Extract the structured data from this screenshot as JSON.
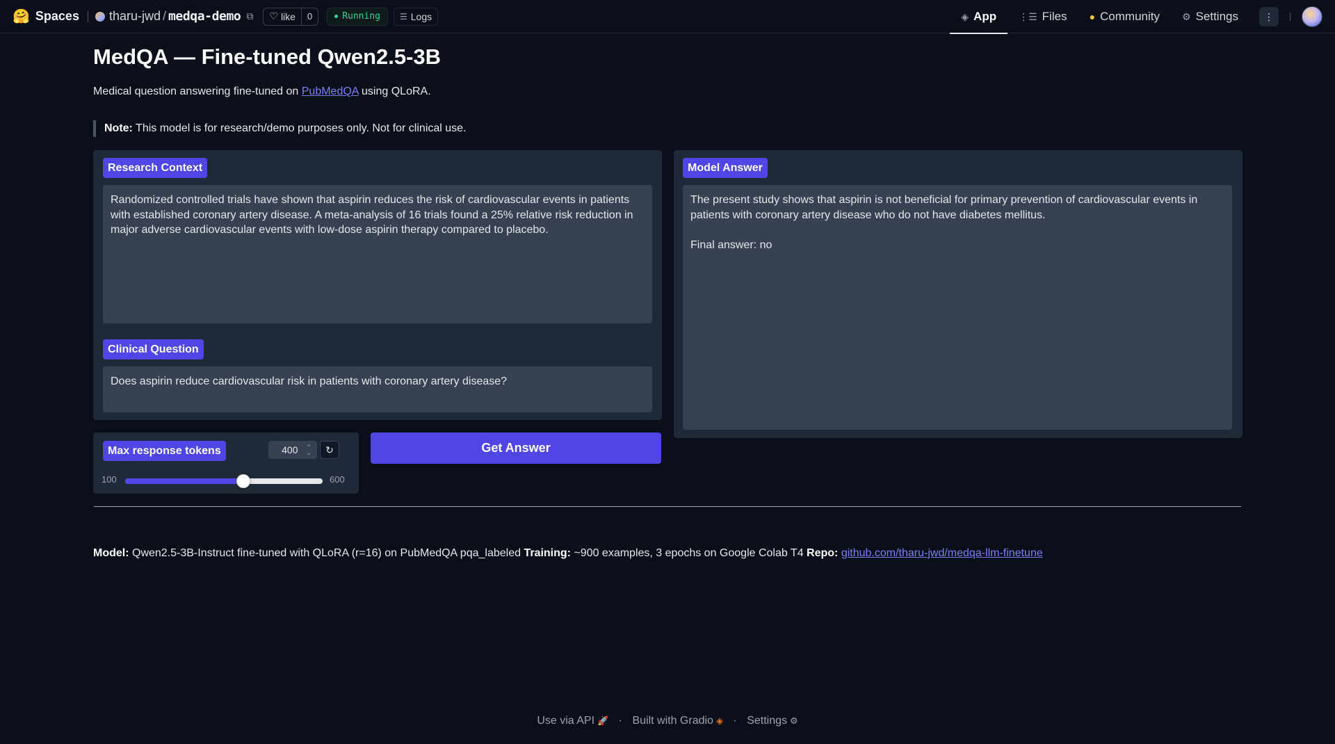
{
  "topbar": {
    "spaces_label": "Spaces",
    "owner": "tharu-jwd",
    "slash": "/",
    "repo": "medqa-demo",
    "like_label": "like",
    "like_count": "0",
    "status": "Running",
    "logs_label": "Logs",
    "tabs": [
      {
        "label": "App",
        "icon": "cube-icon",
        "active": true
      },
      {
        "label": "Files",
        "icon": "files-icon",
        "active": false
      },
      {
        "label": "Community",
        "icon": "community-icon",
        "active": false
      },
      {
        "label": "Settings",
        "icon": "gear-icon",
        "active": false
      }
    ]
  },
  "main": {
    "title": "MedQA — Fine-tuned Qwen2.5-3B",
    "subtitle_prefix": "Medical question answering fine-tuned on ",
    "subtitle_link": "PubMedQA",
    "subtitle_suffix": " using QLoRA.",
    "note_label": "Note:",
    "note_text": " This model is for research/demo purposes only. Not for clinical use."
  },
  "context": {
    "label": "Research Context",
    "value": "Randomized controlled trials have shown that aspirin reduces the risk of cardiovascular events in patients with established coronary artery disease. A meta-analysis of 16 trials found a 25% relative risk reduction in major adverse cardiovascular events with low-dose aspirin therapy compared to placebo."
  },
  "question": {
    "label": "Clinical Question",
    "value": "Does aspirin reduce cardiovascular risk in patients with coronary artery disease?"
  },
  "tokens": {
    "label": "Max response tokens",
    "value": "400",
    "min": "100",
    "max": "600",
    "fraction": 0.6
  },
  "submit_label": "Get Answer",
  "answer": {
    "label": "Model Answer",
    "line1": "The present study shows that aspirin is not beneficial for primary prevention of cardiovascular events in patients with coronary artery disease who do not have diabetes mellitus.",
    "line2": "Final answer: no"
  },
  "footer": {
    "model_label": "Model:",
    "model_text": " Qwen2.5-3B-Instruct fine-tuned with QLoRA (r=16) on PubMedQA pqa_labeled ",
    "training_label": "Training:",
    "training_text": " ~900 examples, 3 epochs on Google Colab T4 ",
    "repo_label": "Repo:",
    "repo_link": "github.com/tharu-jwd/medqa-llm-finetune"
  },
  "bottom": {
    "api": "Use via API",
    "sep": "·",
    "built": "Built with Gradio",
    "settings": "Settings"
  },
  "colors": {
    "accent": "#4f46e5",
    "background": "#0b0f19",
    "panel": "#1f2937",
    "input": "#374151",
    "running": "#34d399"
  }
}
